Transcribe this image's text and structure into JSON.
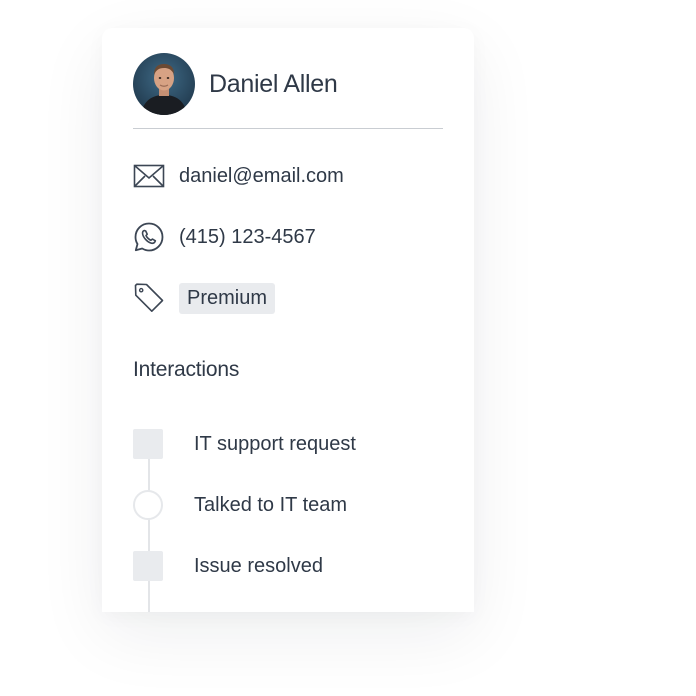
{
  "contact": {
    "name": "Daniel Allen",
    "email": "daniel@email.com",
    "phone": "(415) 123-4567",
    "tag": "Premium"
  },
  "icons": {
    "email": "envelope-icon",
    "phone": "whatsapp-icon",
    "tag": "tag-icon"
  },
  "interactions": {
    "title": "Interactions",
    "items": [
      {
        "label": "IT support request",
        "marker": "square"
      },
      {
        "label": "Talked to IT team",
        "marker": "circle"
      },
      {
        "label": "Issue resolved",
        "marker": "square"
      }
    ]
  },
  "colors": {
    "text": "#2f3947",
    "muted_fill": "#e9ebee",
    "divider": "#c9cdd2"
  }
}
